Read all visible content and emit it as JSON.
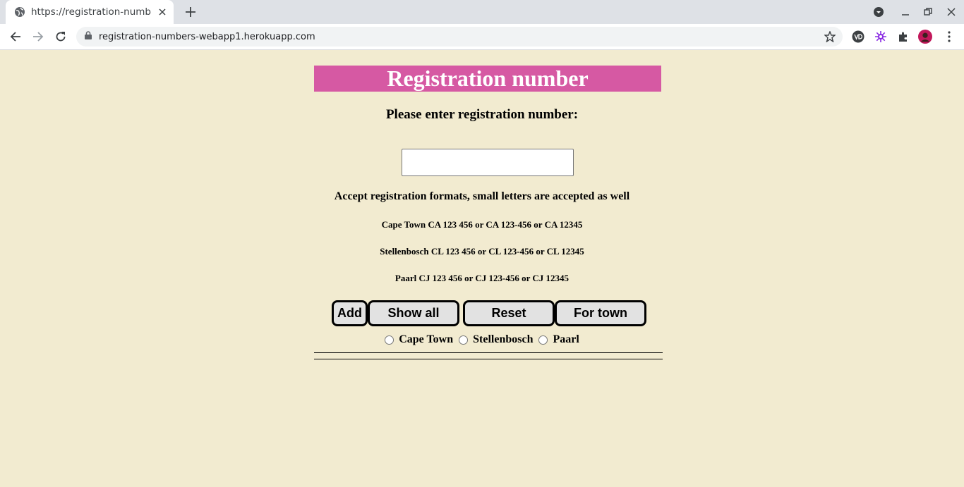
{
  "browser": {
    "tab_title": "https://registration-numb",
    "url": "registration-numbers-webapp1.herokuapp.com"
  },
  "page": {
    "heading": "Registration number",
    "prompt": "Please enter registration number:",
    "input_value": "",
    "formats_heading": "Accept registration formats, small letters are accepted as well",
    "formats": [
      "Cape Town CA 123 456 or CA 123-456 or CA 12345",
      "Stellenbosch CL 123 456 or CL 123-456 or CL 12345",
      "Paarl CJ 123 456 or CJ 123-456 or CJ 12345"
    ],
    "buttons": {
      "add": "Add",
      "show_all": "Show all",
      "reset": "Reset",
      "for_town": "For town"
    },
    "towns": [
      "Cape Town",
      "Stellenbosch",
      "Paarl"
    ]
  },
  "colors": {
    "background": "#f2ebd0",
    "banner": "#d659a3",
    "button": "#e2e2e2"
  }
}
